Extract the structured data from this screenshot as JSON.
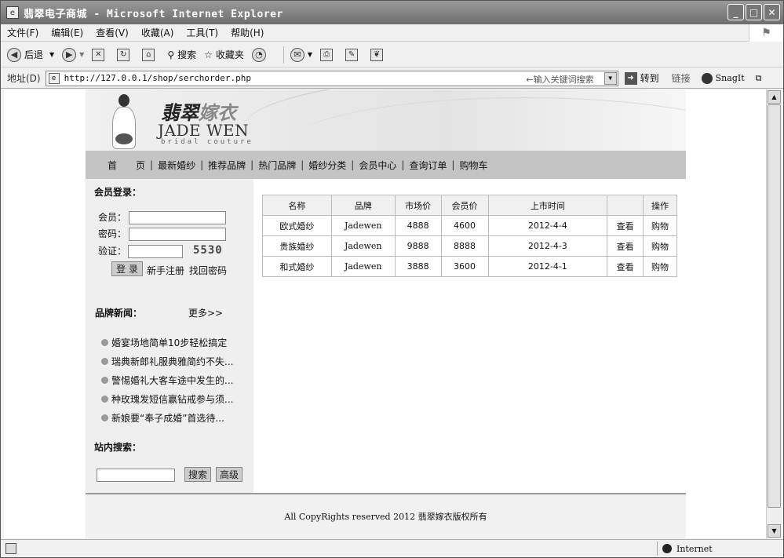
{
  "window": {
    "title": "翡翠电子商城 - Microsoft Internet Explorer",
    "minimize": "_",
    "maximize": "□",
    "close": "✕"
  },
  "menubar": {
    "items": [
      "文件(F)",
      "编辑(E)",
      "查看(V)",
      "收藏(A)",
      "工具(T)",
      "帮助(H)"
    ]
  },
  "toolbar": {
    "back": "后退",
    "search": "搜索",
    "favorites": "收藏夹"
  },
  "addressbar": {
    "label": "地址(D)",
    "url": "http://127.0.0.1/shop/serchorder.php",
    "hint": "←输入关键词搜索",
    "go": "转到",
    "links": "链接",
    "snagit": "SnagIt"
  },
  "site": {
    "brand_cn_dark": "翡翠",
    "brand_cn_light": "嫁衣",
    "brand_en": "JADE WEN",
    "brand_sub": "bridal couture",
    "nav": [
      "首　　页",
      "最新婚纱",
      "推荐品牌",
      "热门品牌",
      "婚纱分类",
      "会员中心",
      "查询订单",
      "购物车"
    ],
    "nav_sep": "|",
    "login": {
      "title": "会员登录：",
      "member_label": "会员：",
      "password_label": "密码：",
      "verify_label": "验证：",
      "captcha": "5530",
      "login_button": "登 录",
      "register": "新手注册",
      "recover": "找回密码"
    },
    "news": {
      "title": "品牌新闻：",
      "more": "更多>>",
      "items": [
        "婚宴场地简单10步轻松搞定",
        "瑞典新郎礼服典雅简约不失...",
        "警惕婚礼大客车途中发生的...",
        "种玫瑰发短信赢钻戒参与须...",
        "新娘要“奉子成婚”首选待..."
      ]
    },
    "site_search": {
      "title": "站内搜索：",
      "search_button": "搜索",
      "advanced_button": "高级"
    },
    "orders": {
      "headers": [
        "名称",
        "品牌",
        "市场价",
        "会员价",
        "上市时间",
        "",
        "操作"
      ],
      "rows": [
        {
          "name": "欧式婚纱",
          "brand": "Jadewen",
          "market": "4888",
          "member": "4600",
          "date": "2012-4-4",
          "view": "查看",
          "cart": "购物"
        },
        {
          "name": "贵族婚纱",
          "brand": "Jadewen",
          "market": "9888",
          "member": "8888",
          "date": "2012-4-3",
          "view": "查看",
          "cart": "购物"
        },
        {
          "name": "和式婚纱",
          "brand": "Jadewen",
          "market": "3888",
          "member": "3600",
          "date": "2012-4-1",
          "view": "查看",
          "cart": "购物"
        }
      ]
    },
    "footer": "All CopyRights reserved 2012 翡翠嫁衣版权所有"
  },
  "statusbar": {
    "zone": "Internet"
  }
}
